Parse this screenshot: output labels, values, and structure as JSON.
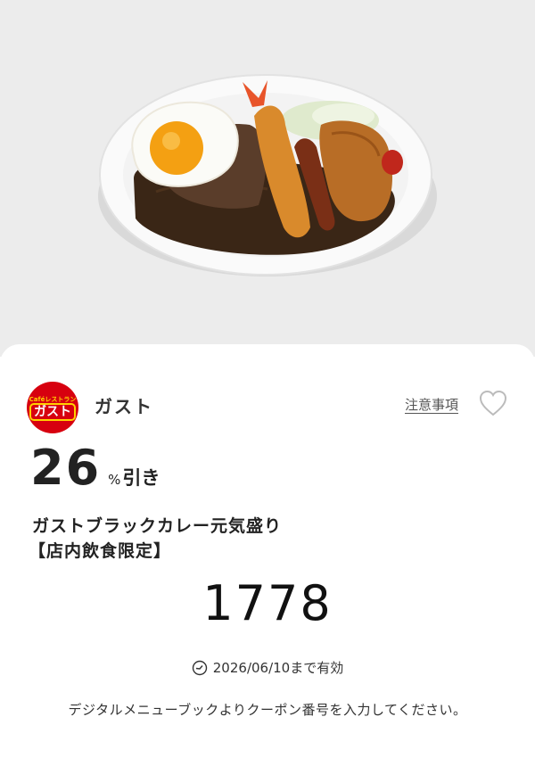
{
  "shop": {
    "logo_sub": "Caféレストラン",
    "logo_main": "ガスト",
    "name": "ガスト"
  },
  "actions": {
    "notes_label": "注意事項"
  },
  "coupon": {
    "discount_value": "26",
    "discount_unit": "%",
    "discount_suffix": "引き",
    "product_name": "ガストブラックカレー元気盛り",
    "restriction": "【店内飲食限定】",
    "code": "1778",
    "expiry": "2026/06/10まで有効",
    "instruction": "デジタルメニューブックよりクーポン番号を入力してください。"
  },
  "colors": {
    "hero_bg": "#ececec",
    "brand_red": "#d7000f",
    "brand_yellow": "#ffd200",
    "heart_outline": "#bbbbbb"
  },
  "icons": {
    "favorite": "heart-outline-icon",
    "clock": "clock-icon"
  }
}
